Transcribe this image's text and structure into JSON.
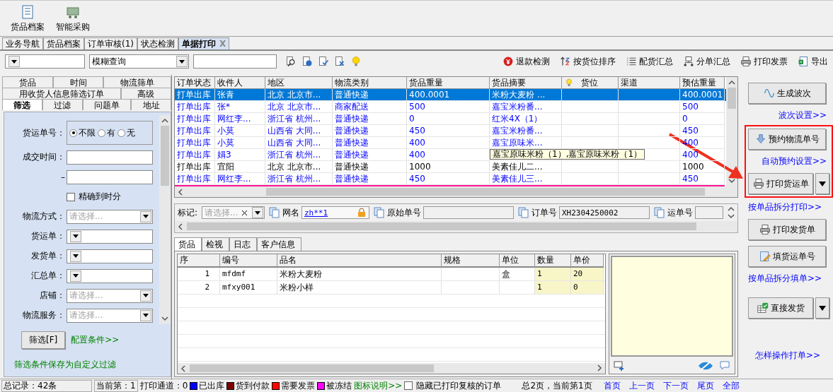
{
  "toolbar": [
    {
      "label": "货品档案"
    },
    {
      "label": "智能采购"
    }
  ],
  "tabs": [
    {
      "label": "业务导航",
      "selected": false
    },
    {
      "label": "货品档案",
      "selected": false
    },
    {
      "label": "订单审核(1)",
      "selected": false
    },
    {
      "label": "状态检测",
      "selected": false
    },
    {
      "label": "单据打印",
      "selected": true,
      "close": "X"
    }
  ],
  "search": {
    "mode": "模糊查询"
  },
  "actions": [
    {
      "label": "退款检测"
    },
    {
      "label": "按货位排序"
    },
    {
      "label": "配货汇总"
    },
    {
      "label": "分单汇总"
    },
    {
      "label": "打印发票"
    },
    {
      "label": "导出"
    }
  ],
  "left_tabs": [
    [
      {
        "label": "货品",
        "selected": false
      },
      {
        "label": "时间",
        "selected": false
      },
      {
        "label": "物流筛单",
        "selected": false
      }
    ],
    [
      {
        "label": "用收货人信息筛选订单",
        "selected": false
      },
      {
        "label": "高级",
        "selected": false
      }
    ],
    [
      {
        "label": "筛选",
        "selected": true
      },
      {
        "label": "过滤",
        "selected": false
      },
      {
        "label": "问题单",
        "selected": false
      },
      {
        "label": "地址",
        "selected": false
      }
    ]
  ],
  "filter": {
    "fields": [
      {
        "kind": "radio",
        "label": "货运单号：",
        "options": [
          {
            "label": "不限",
            "selected": true
          },
          {
            "label": "有",
            "selected": false
          },
          {
            "label": "无",
            "selected": false
          }
        ]
      },
      {
        "kind": "text",
        "label": "成交时间："
      },
      {
        "kind": "text",
        "label": "–"
      },
      {
        "kind": "checkbox",
        "label": "精确到时分",
        "checked": false
      },
      {
        "kind": "select",
        "label": "物流方式：",
        "placeholder": "请选择..."
      },
      {
        "kind": "select",
        "label": "货运单："
      },
      {
        "kind": "select",
        "label": "发货单："
      },
      {
        "kind": "select",
        "label": "汇总单："
      },
      {
        "kind": "select",
        "label": "店铺：",
        "placeholder": "请选择..."
      },
      {
        "kind": "select",
        "label": "物流服务：",
        "placeholder": "请选择..."
      }
    ],
    "button": "筛选[F]",
    "config_link": "配置条件>>",
    "save_link": "筛选条件保存为自定义过滤"
  },
  "orders": {
    "columns": [
      {
        "label": "订单状态"
      },
      {
        "label": "收件人"
      },
      {
        "label": "地区"
      },
      {
        "label": "物流类别"
      },
      {
        "label": "货品重量"
      },
      {
        "label": "货品摘要"
      },
      {
        "label": "货位"
      },
      {
        "label": "渠道"
      },
      {
        "label": "预估重量"
      }
    ],
    "rows": [
      {
        "selected": true,
        "cells": [
          "打单出库",
          "张青",
          "北京 北京市...",
          "普通快递",
          "400.0001",
          "米粉大麦粉 ...",
          null,
          null,
          "400.0001"
        ]
      },
      {
        "selected": false,
        "color": "#0000ff",
        "cells": [
          "打单出库",
          "张*",
          "北京 北京市...",
          "商家配送",
          "500",
          "嘉宝米粉番...",
          null,
          null,
          "500"
        ]
      },
      {
        "selected": false,
        "color": "#0000ff",
        "cells": [
          "打单出库",
          "网红李...",
          "浙江省 杭州...",
          "普通快递",
          "0",
          "红米4X（1）",
          null,
          null,
          "0"
        ]
      },
      {
        "selected": false,
        "color": "#0000ff",
        "cells": [
          "打单出库",
          "小莫",
          "山西省 大同...",
          "普通快递",
          "450",
          "嘉宝米粉番...",
          null,
          null,
          "450"
        ]
      },
      {
        "selected": false,
        "color": "#0000ff",
        "cells": [
          "打单出库",
          "小莫",
          "山西省 大同...",
          "普通快递",
          "400",
          "嘉宝原味米...",
          null,
          null,
          "400"
        ]
      },
      {
        "selected": false,
        "color": "#0000ff",
        "tooltip": "嘉宝原味米粉（1）,嘉宝原味米粉（1）",
        "cells": [
          "打单出库",
          "娟3",
          "浙江省 杭州...",
          "普通快递",
          "400",
          null,
          null,
          null,
          "400"
        ]
      },
      {
        "selected": false,
        "color": "#000000",
        "cells": [
          "打单出库",
          "宜阳",
          "北京 北京市...",
          "普通快递",
          "1000",
          "美素佳儿二...",
          null,
          null,
          "1000"
        ]
      },
      {
        "selected": false,
        "color": "#0000ff",
        "cells": [
          "打单出库",
          "网红李...",
          "浙江省 杭州...",
          "普通快递",
          "450",
          "美素佳儿三...",
          null,
          null,
          "450"
        ]
      }
    ]
  },
  "detail": {
    "tag": {
      "label": "标记:",
      "placeholder": "请选择..."
    },
    "fields": [
      {
        "label": "网名",
        "value": "zh**1",
        "kind": "link"
      },
      {
        "label": "原始单号",
        "kind": "text"
      },
      {
        "label": "订单号",
        "value": "XH2304250002",
        "kind": "text"
      },
      {
        "label": "运单号",
        "kind": "text"
      }
    ]
  },
  "item_tabs": [
    {
      "label": "货品",
      "selected": true
    },
    {
      "label": "检视",
      "selected": false
    },
    {
      "label": "日志",
      "selected": false
    },
    {
      "label": "客户信息",
      "selected": false
    }
  ],
  "items": {
    "columns": [
      "序",
      "编号",
      "品名",
      "规格",
      "单位",
      "数量",
      "单价"
    ],
    "rows": [
      [
        "1",
        "mfdmf",
        "米粉大麦粉",
        null,
        "盒",
        "1",
        "20"
      ],
      [
        "2",
        "mfxy001",
        "米粉小样",
        null,
        null,
        "1",
        "0"
      ]
    ]
  },
  "side": [
    {
      "highlighted": false,
      "items": [
        {
          "kind": "button",
          "label": "生成波次"
        },
        {
          "kind": "link",
          "label": "波次设置>>"
        }
      ]
    },
    {
      "highlighted": true,
      "items": [
        {
          "kind": "button",
          "label": "预约物流单号"
        },
        {
          "kind": "link",
          "label": "自动预约设置>>"
        },
        {
          "kind": "split",
          "label": "打印货运单"
        }
      ]
    },
    {
      "highlighted": false,
      "items": [
        {
          "kind": "link",
          "label": "按单品拆分打印>>"
        },
        {
          "kind": "button",
          "label": "打印发货单"
        },
        {
          "kind": "button",
          "label": "填货运单号"
        },
        {
          "kind": "link",
          "label": "按单品拆分填单>>"
        },
        {
          "kind": "split",
          "label": "直接发货"
        },
        {
          "kind": "link",
          "label": "怎样操作打单>>"
        }
      ]
    }
  ],
  "status": {
    "total": "总记录：42条",
    "current": "当前第：1",
    "channel": "打印通道：0",
    "legend": [
      {
        "label": "已出库",
        "color": "#0000ff"
      },
      {
        "label": "货到付款",
        "color": "#800000"
      },
      {
        "label": "需要发票",
        "color": "#ff0000"
      },
      {
        "label": "被冻结",
        "color": "#ff00ff"
      }
    ],
    "legend_link": "图标说明>>",
    "hide_printed": {
      "label": "隐藏已打印复核的订单",
      "checked": false
    },
    "pages": "总2页，当前第1页",
    "nav": [
      "首页",
      "上一页",
      "下一页",
      "尾页",
      "全部"
    ]
  }
}
